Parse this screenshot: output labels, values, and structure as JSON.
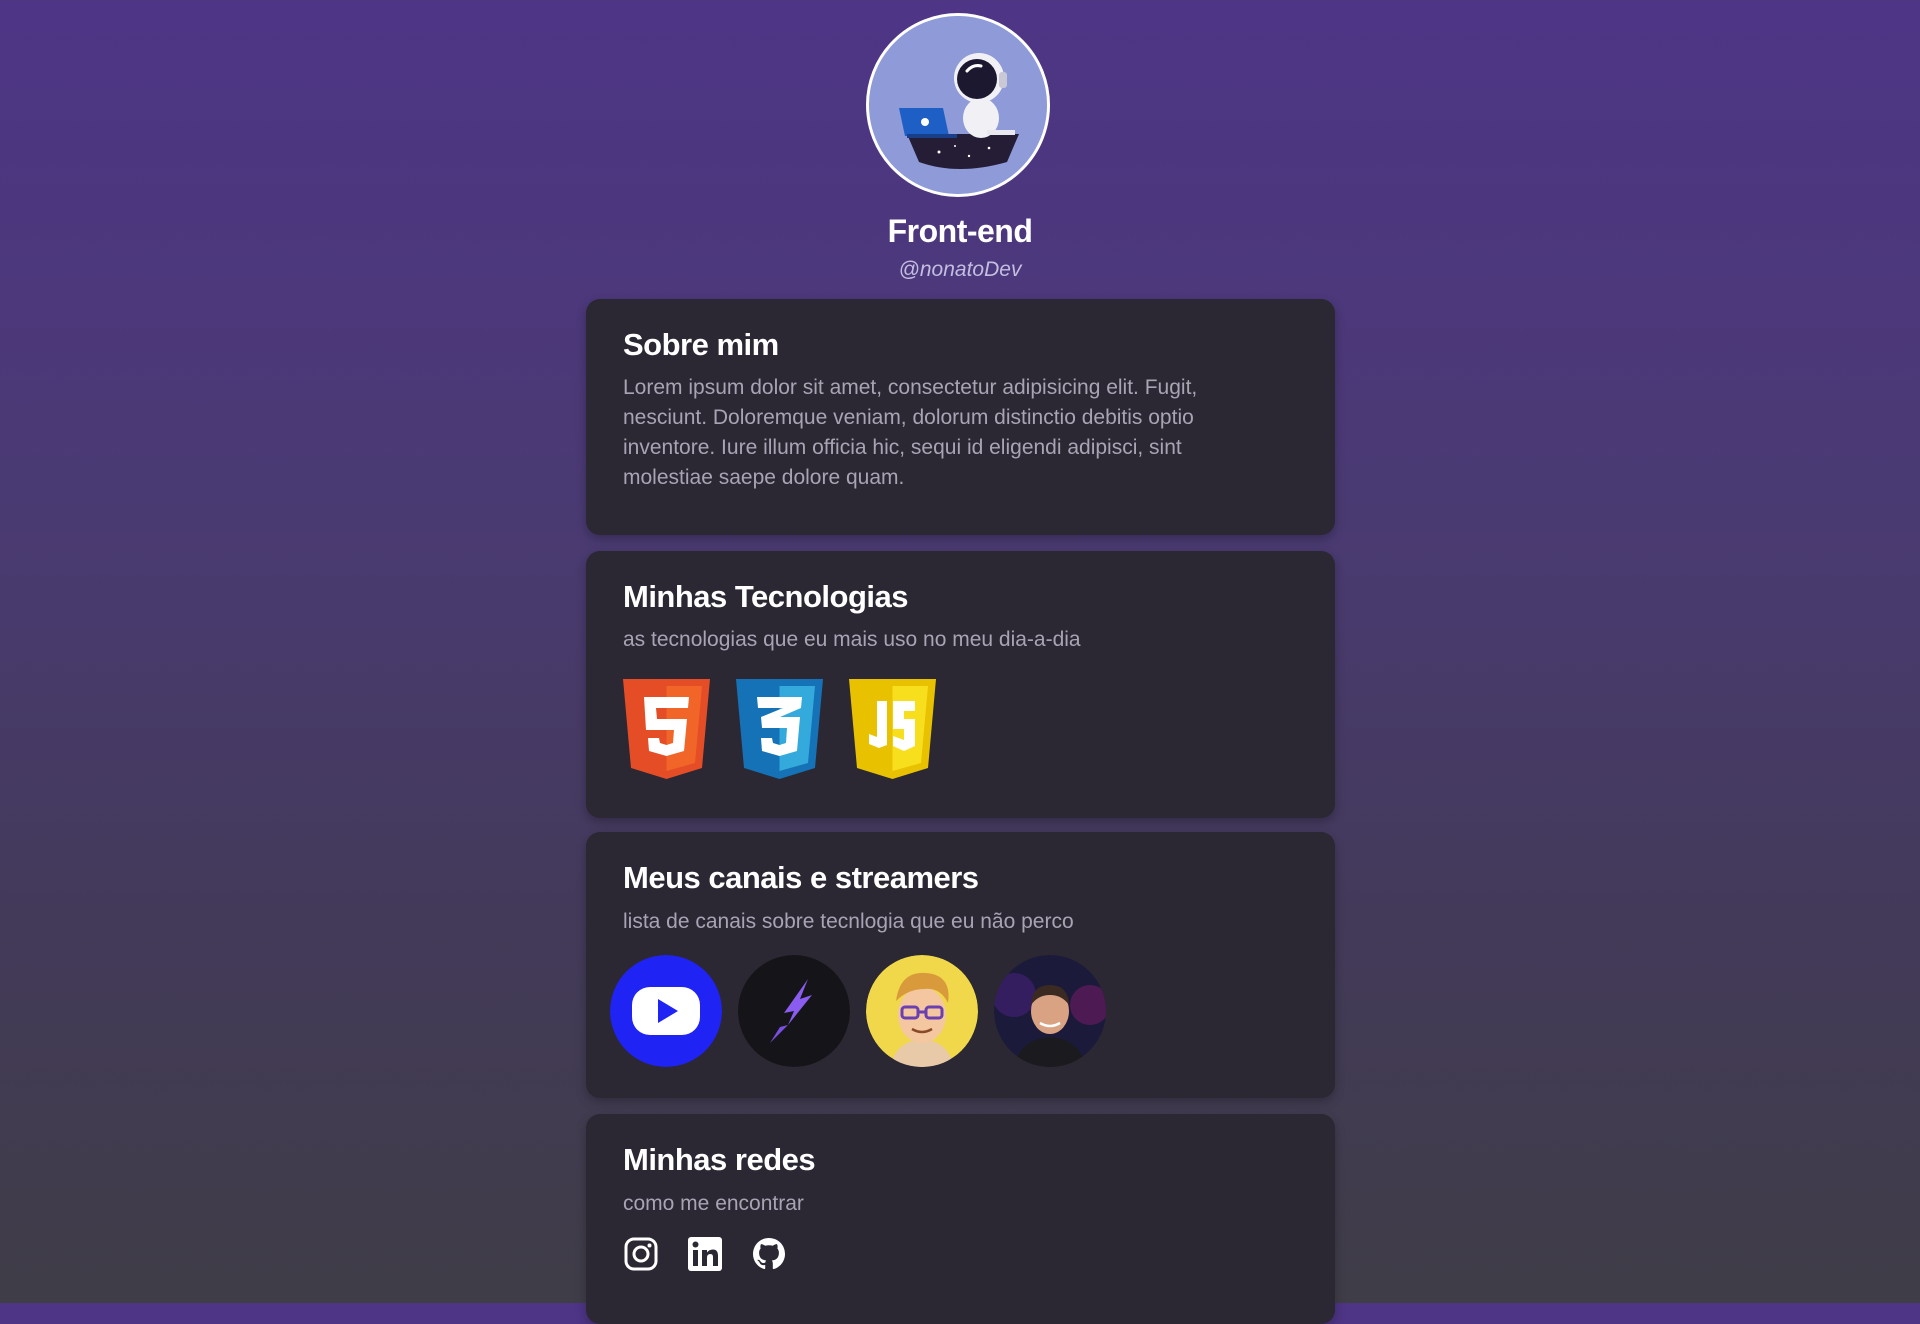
{
  "profile": {
    "name": "Front-end",
    "handle": "@nonatoDev"
  },
  "about": {
    "title": "Sobre mim",
    "text": "Lorem ipsum dolor sit amet, consectetur adipisicing elit. Fugit, nesciunt. Doloremque veniam, dolorum distinctio debitis optio inventore. Iure illum officia hic, sequi id eligendi adipisci, sint molestiae saepe dolore quam."
  },
  "technologies": {
    "title": "Minhas Tecnologias",
    "subtitle": "as tecnologias que eu mais uso no meu dia-a-dia",
    "items": [
      {
        "icon": "html5-icon",
        "color": "#e44d26"
      },
      {
        "icon": "css3-icon",
        "color": "#1572b6"
      },
      {
        "icon": "javascript-icon",
        "color": "#f7df1e"
      }
    ]
  },
  "channels": {
    "title": "Meus canais e streamers",
    "subtitle": "lista de canais sobre tecnlogia que eu não perco",
    "items": [
      {
        "icon": "youtube-play-icon",
        "color": "#1f24f5"
      },
      {
        "icon": "purple-lightning-icon",
        "color": "#151418"
      },
      {
        "icon": "cartoon-developer-avatar",
        "color": "#f0d84a"
      },
      {
        "icon": "streamer-photo-avatar",
        "color": "#1b1a3a"
      }
    ]
  },
  "social": {
    "title": "Minhas redes",
    "subtitle": "como me encontrar",
    "items": [
      {
        "icon": "instagram-icon"
      },
      {
        "icon": "linkedin-icon"
      },
      {
        "icon": "github-icon"
      }
    ]
  },
  "colors": {
    "background_top": "#4e3586",
    "background_bottom": "#3f3d47",
    "card": "#2b2733",
    "muted_text": "#a9a4b4",
    "avatar_bg": "#8f9bd8"
  }
}
